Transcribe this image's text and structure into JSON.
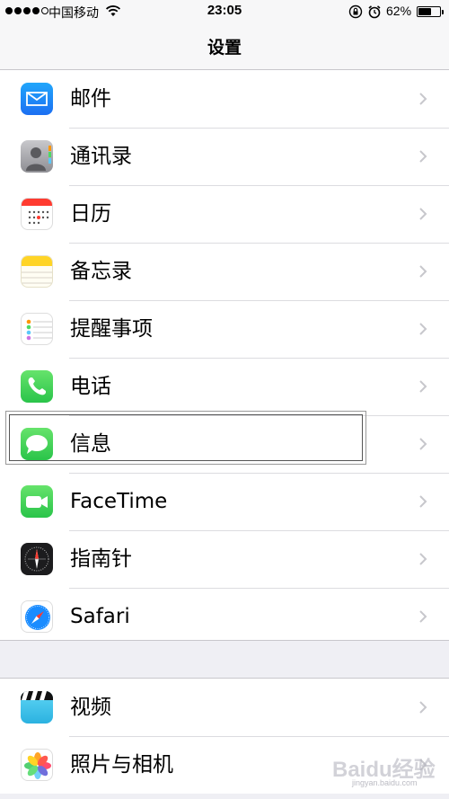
{
  "status_bar": {
    "carrier": "中国移动",
    "time": "23:05",
    "battery_percent": "62%",
    "battery_level": 0.62,
    "signal_bars": 4
  },
  "nav": {
    "title": "设置"
  },
  "group1": [
    {
      "label": "邮件",
      "icon": "mail-icon",
      "color": "#1d8ff6"
    },
    {
      "label": "通讯录",
      "icon": "contacts-icon",
      "color": "#8e8e93"
    },
    {
      "label": "日历",
      "icon": "calendar-icon",
      "color": "#ff3b30"
    },
    {
      "label": "备忘录",
      "icon": "notes-icon",
      "color": "#ffd426"
    },
    {
      "label": "提醒事项",
      "icon": "reminders-icon",
      "color": "#ffffff"
    },
    {
      "label": "电话",
      "icon": "phone-icon",
      "color": "#34c759"
    },
    {
      "label": "信息",
      "icon": "messages-icon",
      "color": "#34c759"
    },
    {
      "label": "FaceTime",
      "icon": "facetime-icon",
      "color": "#34c759"
    },
    {
      "label": "指南针",
      "icon": "compass-icon",
      "color": "#1c1c1e"
    },
    {
      "label": "Safari",
      "icon": "safari-icon",
      "color": "#1a8cff"
    }
  ],
  "group2": [
    {
      "label": "视频",
      "icon": "videos-icon",
      "color": "#3ec7e8"
    },
    {
      "label": "照片与相机",
      "icon": "photos-icon",
      "color": "#ffffff"
    }
  ],
  "watermark": {
    "text": "Baidu经验",
    "sub": "jingyan.baidu.com"
  }
}
